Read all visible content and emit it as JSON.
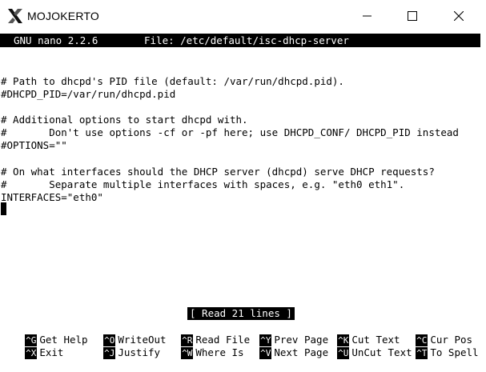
{
  "window": {
    "title": "MOJOKERTO",
    "app_icon": "x-logo-icon",
    "controls": [
      "minimize-icon",
      "maximize-icon",
      "close-icon"
    ]
  },
  "nano": {
    "version": "GNU nano 2.2.6",
    "file": "File: /etc/default/isc-dhcp-server"
  },
  "content_lines": [
    "# Path to dhcpd's PID file (default: /var/run/dhcpd.pid).",
    "#DHCPD_PID=/var/run/dhcpd.pid",
    "",
    "# Additional options to start dhcpd with.",
    "#       Don't use options -cf or -pf here; use DHCPD_CONF/ DHCPD_PID instead",
    "#OPTIONS=\"\"",
    "",
    "# On what interfaces should the DHCP server (dhcpd) serve DHCP requests?",
    "#       Separate multiple interfaces with spaces, e.g. \"eth0 eth1\".",
    "INTERFACES=\"eth0\""
  ],
  "status_message": "[ Read 21 lines ]",
  "shortcuts": [
    {
      "key": "^G",
      "label": "Get Help"
    },
    {
      "key": "^O",
      "label": "WriteOut"
    },
    {
      "key": "^R",
      "label": "Read File"
    },
    {
      "key": "^Y",
      "label": "Prev Page"
    },
    {
      "key": "^K",
      "label": "Cut Text"
    },
    {
      "key": "^C",
      "label": "Cur Pos"
    },
    {
      "key": "^X",
      "label": "Exit"
    },
    {
      "key": "^J",
      "label": "Justify"
    },
    {
      "key": "^W",
      "label": "Where Is"
    },
    {
      "key": "^V",
      "label": "Next Page"
    },
    {
      "key": "^U",
      "label": "UnCut Text"
    },
    {
      "key": "^T",
      "label": "To Spell"
    }
  ]
}
